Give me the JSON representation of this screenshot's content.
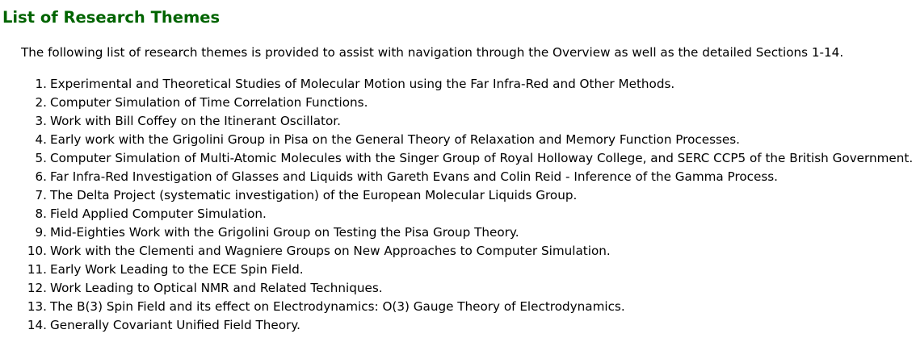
{
  "colors": {
    "heading": "#006400",
    "text": "#000000",
    "background": "#ffffff"
  },
  "page": {
    "title": "List of Research Themes",
    "intro": "The following list of research themes is provided to assist with navigation through the Overview as well as the detailed Sections 1-14."
  },
  "themes": [
    {
      "num": "1.",
      "text": "Experimental and Theoretical Studies of Molecular Motion using the Far Infra-Red and Other Methods."
    },
    {
      "num": "2.",
      "text": "Computer Simulation of Time Correlation Functions."
    },
    {
      "num": "3.",
      "text": "Work with Bill Coffey on the Itinerant Oscillator."
    },
    {
      "num": "4.",
      "text": "Early work with the Grigolini Group in Pisa on the General Theory of Relaxation and Memory Function Processes."
    },
    {
      "num": "5.",
      "text": "Computer Simulation of Multi-Atomic Molecules with the Singer Group of Royal Holloway College, and SERC CCP5 of the British Government."
    },
    {
      "num": "6.",
      "text": "Far Infra-Red Investigation of Glasses and Liquids with Gareth Evans and Colin Reid - Inference of the Gamma Process."
    },
    {
      "num": "7.",
      "text": "The Delta Project (systematic investigation) of the European Molecular Liquids Group."
    },
    {
      "num": "8.",
      "text": "Field Applied Computer Simulation."
    },
    {
      "num": "9.",
      "text": "Mid-Eighties Work with the Grigolini Group on Testing the Pisa Group Theory."
    },
    {
      "num": "10.",
      "text": "Work with the Clementi and Wagniere Groups on New Approaches to Computer Simulation."
    },
    {
      "num": "11.",
      "text": "Early Work Leading to the ECE Spin Field."
    },
    {
      "num": "12.",
      "text": "Work Leading to Optical NMR and Related Techniques."
    },
    {
      "num": "13.",
      "text": "The B(3) Spin Field and its effect on Electrodynamics: O(3) Gauge Theory of Electrodynamics."
    },
    {
      "num": "14.",
      "text": "Generally Covariant Unified Field Theory."
    }
  ]
}
